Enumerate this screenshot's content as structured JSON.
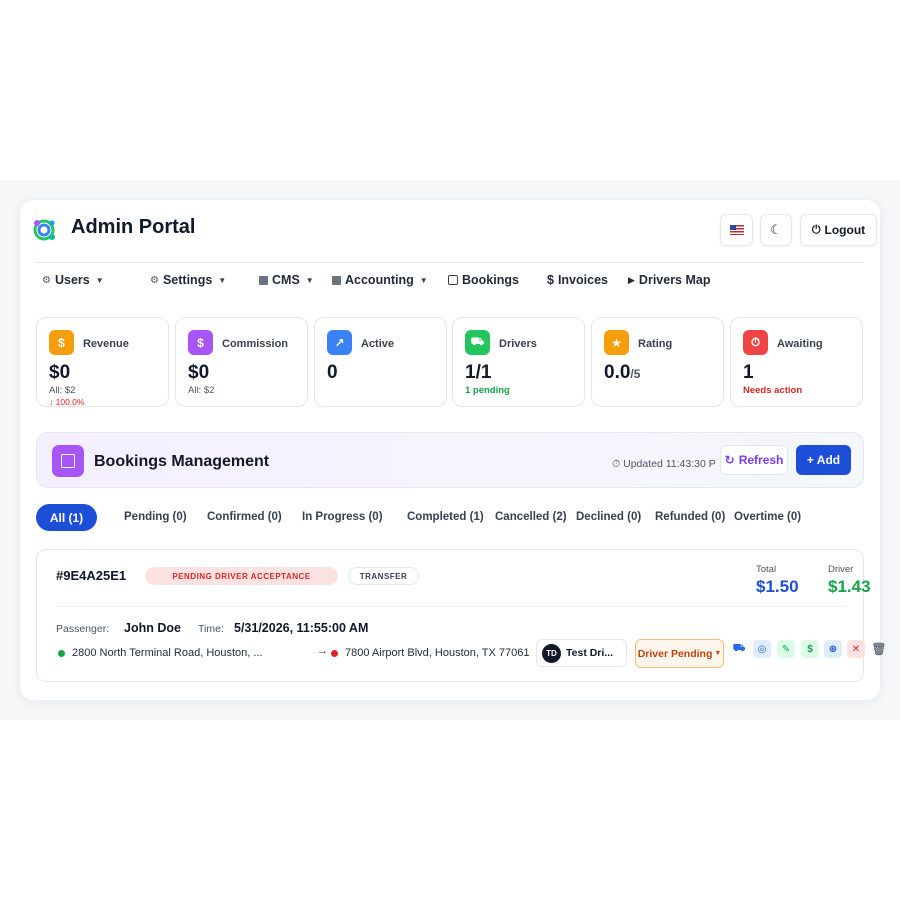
{
  "app": {
    "title": "Admin Portal",
    "language_flag": "us-flag-icon",
    "theme_icon": "moon-icon",
    "logout_label": "Logout"
  },
  "nav": [
    {
      "label": "Users",
      "icon": "gear-icon",
      "dropdown": true
    },
    {
      "label": "Settings",
      "icon": "gear-icon",
      "dropdown": true
    },
    {
      "label": "CMS",
      "icon": "square-icon",
      "dropdown": true
    },
    {
      "label": "Accounting",
      "icon": "square-icon",
      "dropdown": true
    },
    {
      "label": "Bookings",
      "icon": "checkbox-icon",
      "dropdown": false
    },
    {
      "label": "Invoices",
      "icon": "dollar-icon",
      "dropdown": false
    },
    {
      "label": "Drivers Map",
      "icon": "play-icon",
      "dropdown": false
    }
  ],
  "stats": [
    {
      "label": "Revenue",
      "value": "$0",
      "sub": "All: $2",
      "sub2": "↓ 100.0%",
      "icon": "dollar-icon",
      "color": "#f59e0b"
    },
    {
      "label": "Commission",
      "value": "$0",
      "sub": "All: $2",
      "icon": "dollar-icon",
      "color": "#a855f7"
    },
    {
      "label": "Active",
      "value": "0",
      "icon": "arrow-up-icon",
      "color": "#3b82f6"
    },
    {
      "label": "Drivers",
      "value": "1/1",
      "sub": "1 pending",
      "icon": "truck-icon",
      "color": "#22c55e"
    },
    {
      "label": "Rating",
      "value": "0.0",
      "suffix": "/5",
      "icon": "star-icon",
      "color": "#f59e0b"
    },
    {
      "label": "Awaiting",
      "value": "1",
      "sub": "Needs action",
      "icon": "clock-icon",
      "color": "#ef4444"
    }
  ],
  "management": {
    "title": "Bookings Management",
    "updated": "Updated 11:43:30 P",
    "refresh_label": "Refresh",
    "add_label": "+ Add"
  },
  "tabs": [
    {
      "label": "All (1)",
      "active": true
    },
    {
      "label": "Pending (0)"
    },
    {
      "label": "Confirmed (0)"
    },
    {
      "label": "In Progress (0)"
    },
    {
      "label": "Completed (1)"
    },
    {
      "label": "Cancelled (2)"
    },
    {
      "label": "Declined (0)"
    },
    {
      "label": "Refunded (0)"
    },
    {
      "label": "Overtime (0)"
    }
  ],
  "booking": {
    "id": "#9E4A25E1",
    "status": "PENDING DRIVER ACCEPTANCE",
    "type": "TRANSFER",
    "total_label": "Total",
    "total": "$1.50",
    "driver_label": "Driver",
    "driver_amount": "$1.43",
    "passenger_label": "Passenger:",
    "passenger": "John Doe",
    "time_label": "Time:",
    "time": "5/31/2026, 11:55:00 AM",
    "pickup": "2800 North Terminal Road, Houston, ...",
    "dropoff": "7800 Airport Blvd, Houston, TX 77061",
    "driver_initials": "TD",
    "driver_name": "Test Dri...",
    "driver_status": "Driver Pending",
    "actions": [
      "truck-icon",
      "eye-icon",
      "edit-icon",
      "dollar-icon",
      "target-icon",
      "close-icon",
      "trash-icon"
    ]
  }
}
